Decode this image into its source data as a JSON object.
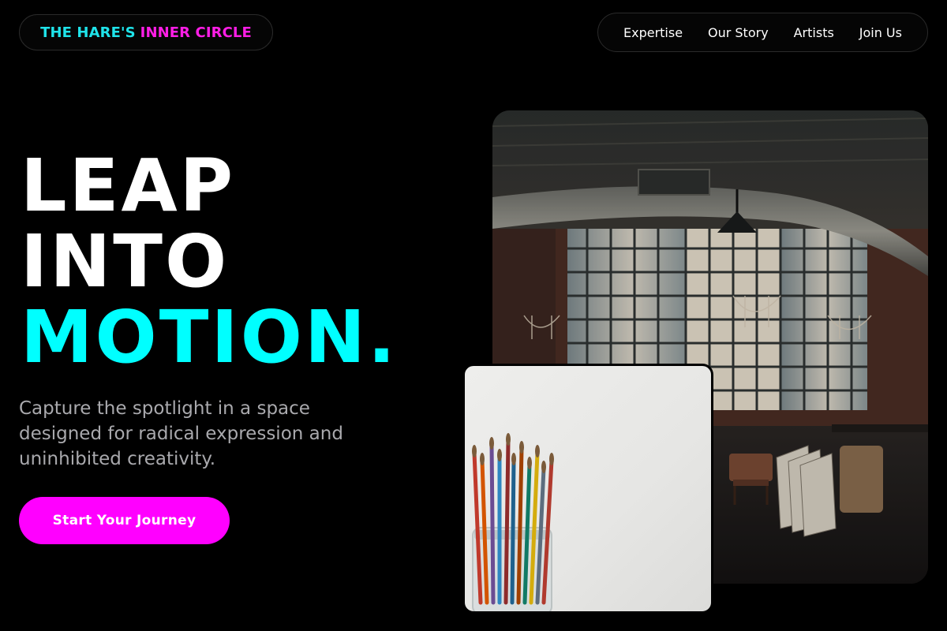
{
  "header": {
    "logo_part1": "THE HARE'S",
    "logo_part2": "INNER CIRCLE",
    "nav": [
      {
        "label": "Expertise"
      },
      {
        "label": "Our Story"
      },
      {
        "label": "Artists"
      },
      {
        "label": "Join Us"
      }
    ]
  },
  "hero": {
    "headline": [
      "LEAP",
      "INTO",
      "MOTION."
    ],
    "subtitle": "Capture the spotlight in a space designed for radical expression and uninhibited creativity.",
    "cta_label": "Start Your Journey"
  },
  "colors": {
    "accent_cyan": "#00ffff",
    "accent_magenta": "#ff00ff",
    "background": "#000000"
  },
  "images": {
    "studio": "industrial-loft-studio-photo",
    "brushes": "paint-brushes-jar-photo"
  }
}
